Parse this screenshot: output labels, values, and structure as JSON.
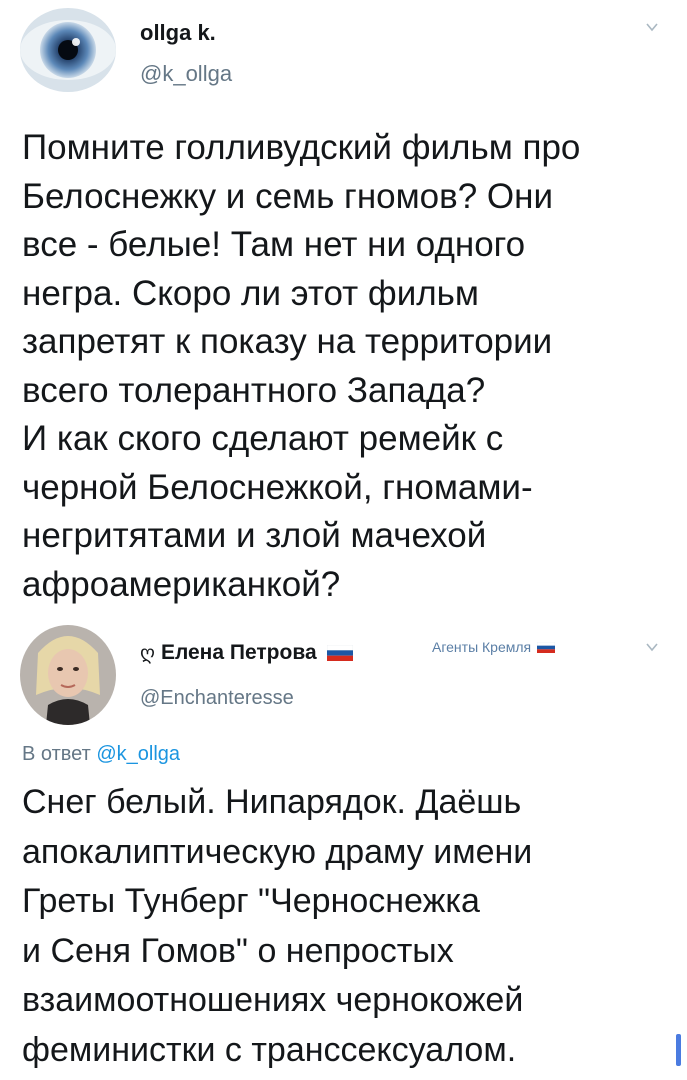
{
  "tweet1": {
    "author_name": "ollga k.",
    "author_handle": "@k_ollga",
    "text": "Помните голливудский фильм про\nБелоснежку и семь гномов? Они\nвсе - белые! Там нет ни одного\nнегра.  Скоро ли этот фильм\nзапретят к показу на территории\nвсего толерантного Запада?\nИ как ского сделают ремейк с\nчерной Белоснежкой, гномами-\nнегритятами и злой мачехой\nафроамериканкой?"
  },
  "tweet2": {
    "author_name": "Елена Петрова",
    "author_handle": "@Enchanteresse",
    "label": "Агенты Кремля",
    "reply_prefix": "В ответ",
    "reply_handle": "@k_ollga",
    "text": "Снег белый. Нипарядок. Даёшь\nапокалиптическую драму имени\nГреты Тунберг \"Черноснежка\nи Сеня Гомов\" о непростых\nвзаимоотношениях чернокожей\nфеминистки с транссексуалом."
  },
  "icons": {
    "chevron": "chevron-down-icon",
    "flag": "russia-flag-icon",
    "prefix_glyph": "georgian-letter-icon"
  },
  "colors": {
    "link": "#1b95e0",
    "secondary_text": "#657786",
    "label": "#5b7fa6"
  }
}
